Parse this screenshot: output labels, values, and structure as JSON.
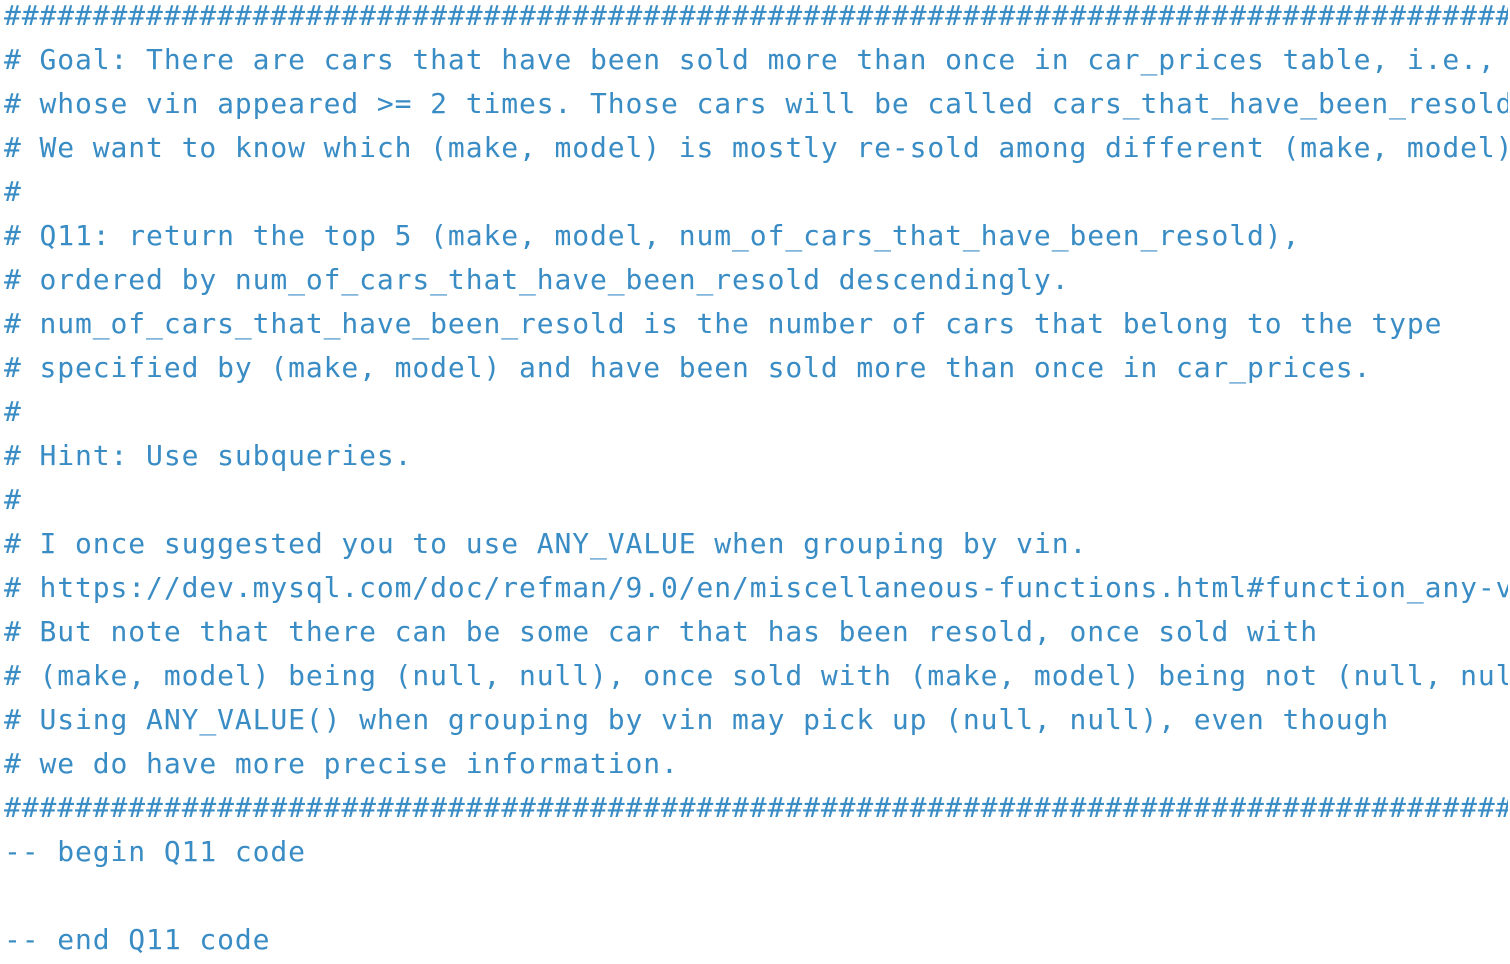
{
  "editor": {
    "colors": {
      "background": "#ffffff",
      "comment_text": "#3a8cc4"
    },
    "lines": [
      "#####################################################################################",
      "# Goal: There are cars that have been sold more than once in car_prices table, i.e.,",
      "# whose vin appeared >= 2 times. Those cars will be called cars_that_have_been_resold.",
      "# We want to know which (make, model) is mostly re-sold among different (make, model)'s.",
      "#",
      "# Q11: return the top 5 (make, model, num_of_cars_that_have_been_resold),",
      "# ordered by num_of_cars_that_have_been_resold descendingly.",
      "# num_of_cars_that_have_been_resold is the number of cars that belong to the type",
      "# specified by (make, model) and have been sold more than once in car_prices.",
      "#",
      "# Hint: Use subqueries.",
      "#",
      "# I once suggested you to use ANY_VALUE when grouping by vin.",
      "# https://dev.mysql.com/doc/refman/9.0/en/miscellaneous-functions.html#function_any-value",
      "# But note that there can be some car that has been resold, once sold with",
      "# (make, model) being (null, null), once sold with (make, model) being not (null, null).",
      "# Using ANY_VALUE() when grouping by vin may pick up (null, null), even though",
      "# we do have more precise information.",
      "#####################################################################################",
      "-- begin Q11 code",
      "",
      "-- end Q11 code"
    ]
  }
}
